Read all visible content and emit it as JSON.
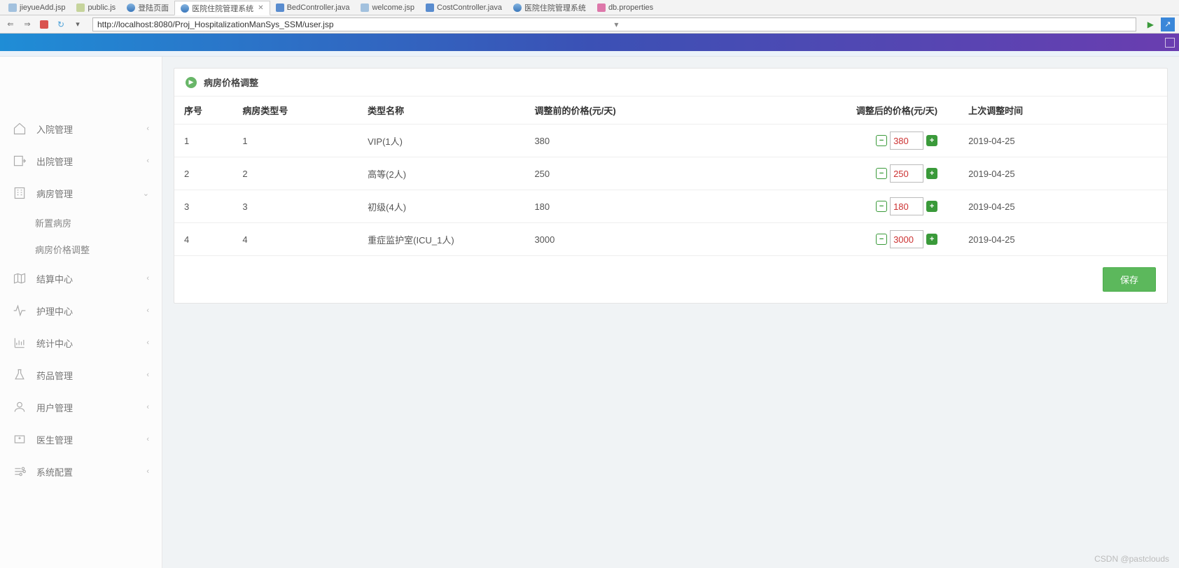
{
  "ide_tabs": [
    {
      "icon": "ic-j",
      "label": "jieyueAdd.jsp"
    },
    {
      "icon": "ic-js",
      "label": "public.js"
    },
    {
      "icon": "ic-w",
      "label": "登陆页面"
    },
    {
      "icon": "ic-w",
      "label": "医院住院管理系统",
      "active": true
    },
    {
      "icon": "ic-java",
      "label": "BedController.java"
    },
    {
      "icon": "ic-j",
      "label": "welcome.jsp"
    },
    {
      "icon": "ic-java",
      "label": "CostController.java"
    },
    {
      "icon": "ic-w",
      "label": "医院住院管理系统"
    },
    {
      "icon": "ic-p",
      "label": "db.properties"
    }
  ],
  "url": "http://localhost:8080/Proj_HospitalizationManSys_SSM/user.jsp",
  "sidebar": [
    {
      "icon": "home",
      "label": "入院管理",
      "chev": "‹"
    },
    {
      "icon": "exit",
      "label": "出院管理",
      "chev": "‹"
    },
    {
      "icon": "building",
      "label": "病房管理",
      "chev": "⌄",
      "open": true,
      "children": [
        {
          "label": "新置病房"
        },
        {
          "label": "病房价格调整"
        }
      ]
    },
    {
      "icon": "map",
      "label": "结算中心",
      "chev": "‹"
    },
    {
      "icon": "pulse",
      "label": "护理中心",
      "chev": "‹"
    },
    {
      "icon": "chart",
      "label": "统计中心",
      "chev": "‹"
    },
    {
      "icon": "flask",
      "label": "药品管理",
      "chev": "‹"
    },
    {
      "icon": "user",
      "label": "用户管理",
      "chev": "‹"
    },
    {
      "icon": "doctor",
      "label": "医生管理",
      "chev": "‹"
    },
    {
      "icon": "settings",
      "label": "系统配置",
      "chev": "‹"
    }
  ],
  "panel": {
    "title": "病房价格调整",
    "columns": [
      "序号",
      "病房类型号",
      "类型名称",
      "调整前的价格(元/天)",
      "调整后的价格(元/天)",
      "上次调整时间"
    ],
    "rows": [
      {
        "seq": "1",
        "type": "1",
        "name": "VIP(1人)",
        "old": "380",
        "new": "380",
        "date": "2019-04-25"
      },
      {
        "seq": "2",
        "type": "2",
        "name": "高等(2人)",
        "old": "250",
        "new": "250",
        "date": "2019-04-25"
      },
      {
        "seq": "3",
        "type": "3",
        "name": "初级(4人)",
        "old": "180",
        "new": "180",
        "date": "2019-04-25"
      },
      {
        "seq": "4",
        "type": "4",
        "name": "重症监护室(ICU_1人)",
        "old": "3000",
        "new": "3000",
        "date": "2019-04-25"
      }
    ],
    "save": "保存"
  },
  "watermark": "CSDN @pastclouds"
}
